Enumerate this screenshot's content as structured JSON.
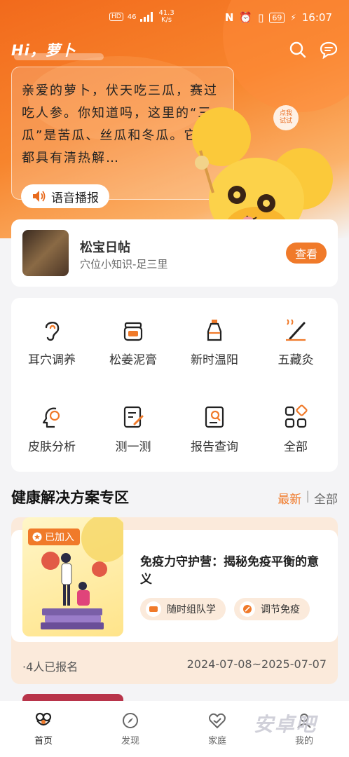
{
  "status_bar": {
    "hd": "HD",
    "signal": "46",
    "net_speed_value": "41.3",
    "net_speed_unit": "K/s",
    "battery": "69",
    "time": "16:07"
  },
  "header": {
    "greeting": "Hi，萝卜",
    "icons": [
      "search-icon",
      "message-icon"
    ]
  },
  "assistant": {
    "message": "亲爱的萝卜，伏天吃三瓜，赛过吃人参。你知道吗，这里的“三瓜”是苦瓜、丝瓜和冬瓜。它们都具有清热解…",
    "voice_button": "语音播报",
    "try_badge": [
      "点我",
      "试试"
    ]
  },
  "daily_post": {
    "title": "松宝日帖",
    "subtitle": "穴位小知识-足三里",
    "view_button": "查看"
  },
  "services": [
    {
      "label": "耳穴调养",
      "icon": "ear-icon"
    },
    {
      "label": "松姜泥膏",
      "icon": "jar-icon"
    },
    {
      "label": "新时温阳",
      "icon": "bottle-icon"
    },
    {
      "label": "五藏灸",
      "icon": "moxa-icon"
    },
    {
      "label": "皮肤分析",
      "icon": "face-icon"
    },
    {
      "label": "测一测",
      "icon": "test-icon"
    },
    {
      "label": "报告查询",
      "icon": "report-icon"
    },
    {
      "label": "全部",
      "icon": "grid-icon"
    }
  ],
  "solutions": {
    "title": "健康解决方案专区",
    "tab_latest": "最新",
    "separator": "|",
    "tab_all": "全部",
    "card": {
      "badge": "已加入",
      "title": "免疫力守护营：揭秘免疫平衡的意义",
      "tags": [
        "随时组队学",
        "调节免疫"
      ],
      "signup": "·4人已报名",
      "date_range": "2024-07-08~2025-07-07"
    }
  },
  "tab_bar": [
    {
      "label": "首页",
      "icon": "home-icon",
      "active": true
    },
    {
      "label": "发现",
      "icon": "compass-icon",
      "active": false
    },
    {
      "label": "家庭",
      "icon": "family-icon",
      "active": false
    },
    {
      "label": "我的",
      "icon": "profile-icon",
      "active": false
    }
  ],
  "watermark": "安卓吧",
  "colors": {
    "accent": "#f07a2a",
    "hero_start": "#f26a1c",
    "page_bg": "#f4f4f6"
  }
}
